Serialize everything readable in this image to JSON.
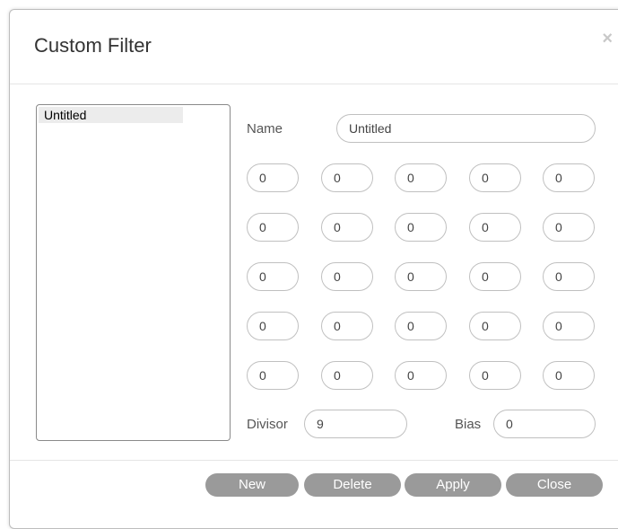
{
  "dialog": {
    "title": "Custom Filter",
    "close_glyph": "×"
  },
  "list": {
    "items": [
      {
        "label": "Untitled"
      }
    ]
  },
  "form": {
    "name_label": "Name",
    "name_value": "Untitled",
    "matrix": [
      [
        "0",
        "0",
        "0",
        "0",
        "0"
      ],
      [
        "0",
        "0",
        "0",
        "0",
        "0"
      ],
      [
        "0",
        "0",
        "0",
        "0",
        "0"
      ],
      [
        "0",
        "0",
        "0",
        "0",
        "0"
      ],
      [
        "0",
        "0",
        "0",
        "0",
        "0"
      ]
    ],
    "divisor_label": "Divisor",
    "divisor_value": "9",
    "bias_label": "Bias",
    "bias_value": "0"
  },
  "footer": {
    "new_label": "New",
    "delete_label": "Delete",
    "apply_label": "Apply",
    "close_label": "Close"
  },
  "colors": {
    "button_bg": "#9a9a9a",
    "selected_item_bg": "#ececec"
  }
}
